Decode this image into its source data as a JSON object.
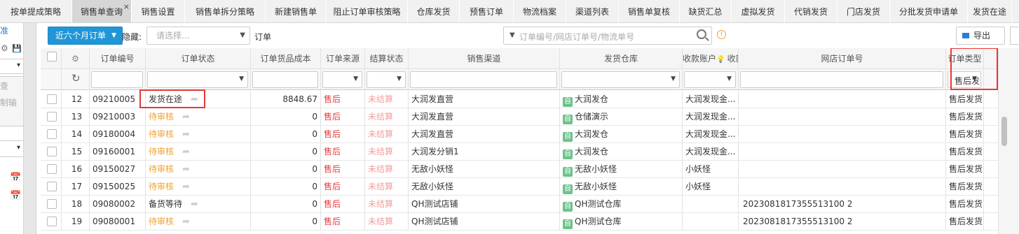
{
  "tabs": [
    {
      "label": "按单提成策略",
      "w": 103
    },
    {
      "label": "销售单查询",
      "w": 85,
      "active": true
    },
    {
      "label": "销售设置",
      "w": 76
    },
    {
      "label": "销售单拆分策略",
      "w": 115
    },
    {
      "label": "新建销售单",
      "w": 87
    },
    {
      "label": "阻止订单审核策略",
      "w": 116
    },
    {
      "label": "仓库发货",
      "w": 74
    },
    {
      "label": "预售订单",
      "w": 77
    },
    {
      "label": "物流档案",
      "w": 75
    },
    {
      "label": "渠道列表",
      "w": 75
    },
    {
      "label": "销售单复核",
      "w": 87
    },
    {
      "label": "缺货汇总",
      "w": 74
    },
    {
      "label": "虚拟发货",
      "w": 76
    },
    {
      "label": "代销发货",
      "w": 75
    },
    {
      "label": "门店发货",
      "w": 75
    },
    {
      "label": "分批发货申请单",
      "w": 111
    },
    {
      "label": "发货在途",
      "w": 63
    }
  ],
  "tab_close_glyph": "×",
  "left": {
    "t1": "准",
    "t2": "⚙",
    "t3": "💾",
    "t4": "▾",
    "t5": "查",
    "t6": "制输",
    "t7": "▾",
    "t8": "📅",
    "t9": "📅"
  },
  "toolbar": {
    "period": "近六个月订单",
    "hide_label": "隐藏:",
    "hide_placeholder": "请选择...",
    "order_label": "订单",
    "search_placeholder": "订单编号/网店订单号/物流单号",
    "export": "导出",
    "info": "!"
  },
  "columns": [
    {
      "label": "",
      "w": 30
    },
    {
      "label": "⚙",
      "w": 40
    },
    {
      "label": "订单编号",
      "w": 80
    },
    {
      "label": "订单状态",
      "w": 150
    },
    {
      "label": "订单货品成本",
      "w": 100
    },
    {
      "label": "订单来源",
      "w": 63
    },
    {
      "label": "结算状态",
      "w": 62
    },
    {
      "label": "销售渠道",
      "w": 216
    },
    {
      "label": "发货仓库",
      "w": 175
    },
    {
      "label": "收款账户",
      "w": 80
    },
    {
      "label": "网店订单号",
      "w": 296
    },
    {
      "label": "订单类型",
      "w": 54
    }
  ],
  "filter_order_type": "售后发",
  "rows": [
    {
      "n": "12",
      "no": "09210005",
      "status": "发货在途",
      "status_c": "",
      "cost": "8848.67",
      "src": "售后",
      "settle": "未结算",
      "channel": "大润发直营",
      "wh": "大润发仓",
      "acc": "大润发现金...",
      "shop": "",
      "type": "售后发货"
    },
    {
      "n": "13",
      "no": "09210003",
      "status": "待审核",
      "status_c": "muted",
      "cost": "0",
      "src": "售后",
      "settle": "未结算",
      "channel": "大润发直营",
      "wh": "仓储演示",
      "acc": "大润发现金...",
      "shop": "",
      "type": "售后发货"
    },
    {
      "n": "14",
      "no": "09180004",
      "status": "待审核",
      "status_c": "muted",
      "cost": "0",
      "src": "售后",
      "settle": "未结算",
      "channel": "大润发直营",
      "wh": "大润发仓",
      "acc": "大润发现金...",
      "shop": "",
      "type": "售后发货"
    },
    {
      "n": "15",
      "no": "09160001",
      "status": "待审核",
      "status_c": "muted",
      "cost": "0",
      "src": "售后",
      "settle": "未结算",
      "channel": "大润发分销1",
      "wh": "大润发仓",
      "acc": "大润发现金...",
      "shop": "",
      "type": "售后发货"
    },
    {
      "n": "16",
      "no": "09150027",
      "status": "待审核",
      "status_c": "muted",
      "cost": "0",
      "src": "售后",
      "settle": "未结算",
      "channel": "无敌小妖怪",
      "wh": "无敌小妖怪",
      "acc": "小妖怪",
      "shop": "",
      "type": "售后发货"
    },
    {
      "n": "17",
      "no": "09150025",
      "status": "待审核",
      "status_c": "muted",
      "cost": "0",
      "src": "售后",
      "settle": "未结算",
      "channel": "无敌小妖怪",
      "wh": "无敌小妖怪",
      "acc": "小妖怪",
      "shop": "",
      "type": "售后发货"
    },
    {
      "n": "18",
      "no": "09080002",
      "status": "备货等待",
      "status_c": "",
      "cost": "0",
      "src": "售后",
      "settle": "未结算",
      "channel": "QH测试店铺",
      "wh": "QH测试仓库",
      "acc": "",
      "shop": "2023081817355513100 2",
      "type": "售后发货"
    },
    {
      "n": "19",
      "no": "09080001",
      "status": "待审核",
      "status_c": "muted",
      "cost": "0",
      "src": "售后",
      "settle": "未结算",
      "channel": "QH测试店铺",
      "wh": "QH测试仓库",
      "acc": "",
      "shop": "2023081817355513100 2",
      "type": "售后发货"
    }
  ],
  "wh_badge": "自",
  "fwd_glyph": "➦"
}
